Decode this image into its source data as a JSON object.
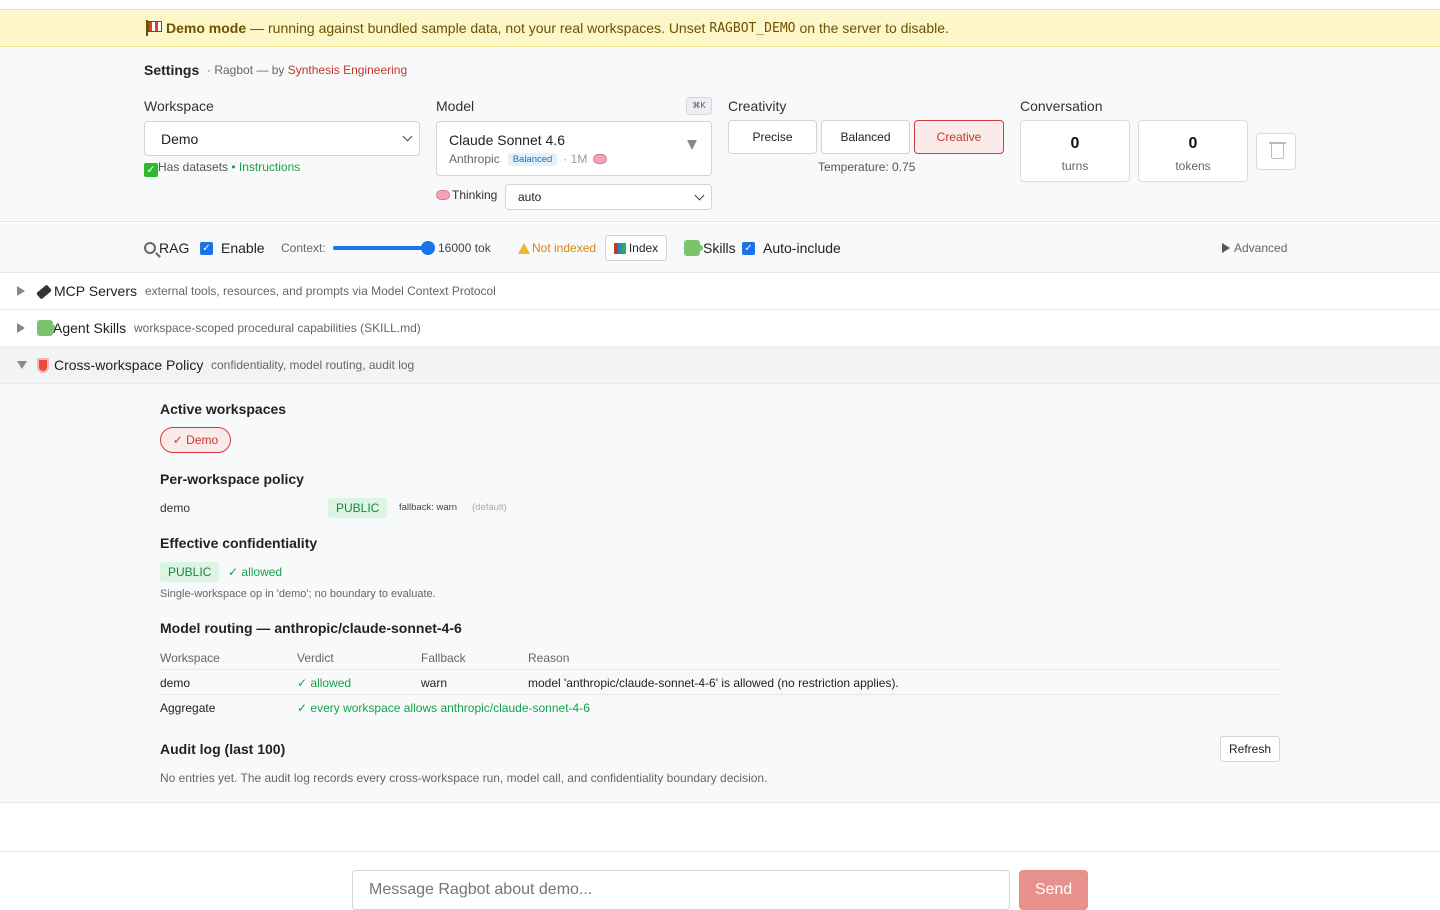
{
  "banner": {
    "bold": "Demo mode",
    "text_before": "— running against bundled sample data, not your real workspaces. Unset",
    "code": "RAGBOT_DEMO",
    "text_after": "on the server to disable."
  },
  "settings": {
    "title": "Settings",
    "subtitle_prefix": "· Ragbot — by",
    "org": "Synthesis Engineering",
    "workspace": {
      "label": "Workspace",
      "value": "Demo",
      "status_check": "✓",
      "status_text": "Has datasets",
      "status_sep": " • ",
      "instructions_link": "Instructions"
    },
    "model": {
      "label": "Model",
      "shortcut": "⌘K",
      "name": "Claude Sonnet 4.6",
      "provider": "Anthropic",
      "tier_badge": "Balanced",
      "context": "· 1M",
      "thinking_label": "Thinking",
      "thinking_value": "auto"
    },
    "creativity": {
      "label": "Creativity",
      "options": [
        "Precise",
        "Balanced",
        "Creative"
      ],
      "selected": "Creative",
      "temperature": "Temperature: 0.75"
    },
    "conversation": {
      "label": "Conversation",
      "turns_value": "0",
      "turns_label": "turns",
      "tokens_value": "0",
      "tokens_label": "tokens"
    }
  },
  "rag_bar": {
    "rag_label": "RAG",
    "enable_label": "Enable",
    "context_label": "Context:",
    "context_value": "16000 tok",
    "context_fraction": 1.0,
    "index_status": "Not indexed",
    "index_button": "Index",
    "skills_label": "Skills",
    "auto_include_label": "Auto-include",
    "advanced_label": "Advanced"
  },
  "sections": [
    {
      "name": "MCP Servers",
      "desc": "external tools, resources, and prompts via Model Context Protocol"
    },
    {
      "name": "Agent Skills",
      "desc": "workspace-scoped procedural capabilities (SKILL.md)"
    },
    {
      "name": "Cross-workspace Policy",
      "desc": "confidentiality, model routing, audit log"
    }
  ],
  "policy": {
    "active_title": "Active workspaces",
    "active_pill": "✓ Demo",
    "per_ws_title": "Per-workspace policy",
    "per_ws_name": "demo",
    "per_ws_level": "PUBLIC",
    "per_ws_fallback": "fallback: warn",
    "per_ws_default": "(default)",
    "eff_title": "Effective confidentiality",
    "eff_level": "PUBLIC",
    "eff_allowed": "✓ allowed",
    "eff_note": "Single-workspace op in 'demo'; no boundary to evaluate.",
    "routing_title": "Model routing — anthropic/claude-sonnet-4-6",
    "routing_headers": [
      "Workspace",
      "Verdict",
      "Fallback",
      "Reason"
    ],
    "routing_row": {
      "workspace": "demo",
      "verdict": "✓ allowed",
      "fallback": "warn",
      "reason": "model 'anthropic/claude-sonnet-4-6' is allowed (no restriction applies)."
    },
    "aggregate_label": "Aggregate",
    "aggregate_value": "✓ every workspace allows anthropic/claude-sonnet-4-6",
    "audit_title": "Audit log (last 100)",
    "refresh_button": "Refresh",
    "audit_empty": "No entries yet. The audit log records every cross-workspace run, model call, and confidentiality boundary decision."
  },
  "composer": {
    "placeholder": "Message Ragbot about demo...",
    "send": "Send"
  }
}
